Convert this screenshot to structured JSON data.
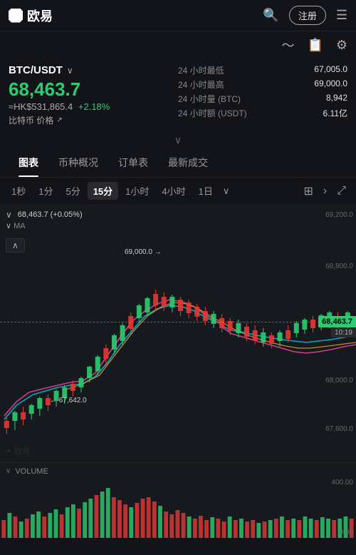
{
  "header": {
    "logo_text": "欧易",
    "register_label": "注册",
    "menu_icon": "☰",
    "search_icon": "🔍"
  },
  "sub_header": {
    "icons": [
      "pulse-icon",
      "document-icon",
      "settings-icon"
    ]
  },
  "price_section": {
    "pair": "BTC/USDT",
    "main_price": "68,463.7",
    "hk_price": "≈HK$531,865.4",
    "change_pct": "+2.18%",
    "btc_label": "比特币 价格",
    "stats": [
      {
        "label": "24 小时最低",
        "value": "67,005.0"
      },
      {
        "label": "24 小时最高",
        "value": "69,000.0"
      },
      {
        "label": "24 小时量 (BTC)",
        "value": "8,942"
      },
      {
        "label": "24 小时额 (USDT)",
        "value": "6.11亿"
      }
    ]
  },
  "tabs": [
    "图表",
    "币种概况",
    "订单表",
    "最新成交"
  ],
  "active_tab": 0,
  "periods": [
    "1秒",
    "1分",
    "5分",
    "15分",
    "1小时",
    "4小时",
    "1日"
  ],
  "active_period": 3,
  "chart": {
    "price_current": "68,463.7",
    "time_current": "10:19",
    "price_info": "68,463.7 (+0.05%)",
    "ma_label": "MA",
    "annotation_high": "69,000.0 →",
    "annotation_low": "← 67,642.0",
    "y_labels": [
      "69,200.0",
      "68,800.0",
      "68,463.7",
      "68,000.0",
      "67,600.0"
    ],
    "price_label_color": "#2ecc71"
  },
  "volume": {
    "title": "VOLUME",
    "y_top": "400.00",
    "y_bottom": "0.00"
  }
}
